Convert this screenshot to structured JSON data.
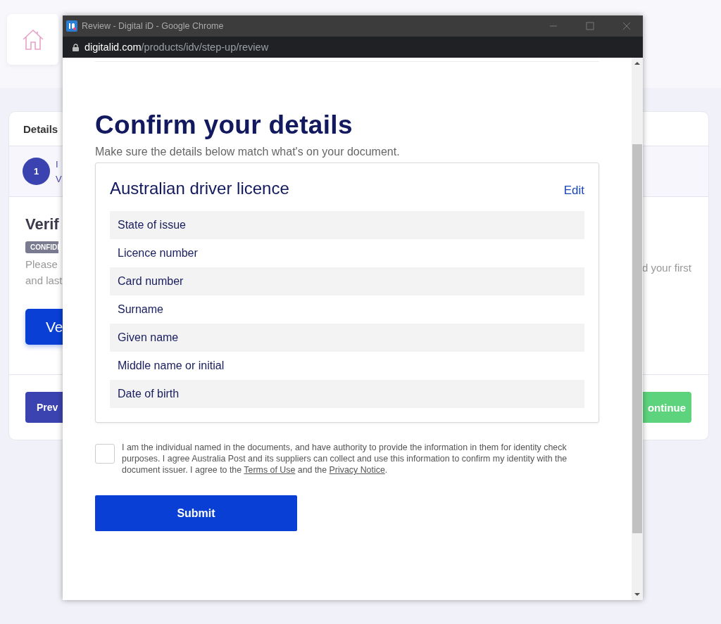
{
  "background_page": {
    "tab": "Details",
    "step": {
      "number": "1",
      "title": "I",
      "subtitle": "V"
    },
    "heading": "Verif",
    "badge": "CONFIDI",
    "text_left": [
      "Please",
      "and last"
    ],
    "text_right": "d your first",
    "primary_button": "Ve",
    "previous_button": "Prev",
    "continue_button": "ontinue"
  },
  "popup": {
    "window_title": "Review - Digital iD - Google Chrome",
    "url_host": "digitalid.com",
    "url_path": "/products/idv/step-up/review",
    "heading": "Confirm your details",
    "subtitle": "Make sure the details below match what's on your document.",
    "document": {
      "title": "Australian driver licence",
      "edit": "Edit",
      "fields": [
        "State of issue",
        "Licence number",
        "Card number",
        "Surname",
        "Given name",
        "Middle name or initial",
        "Date of birth"
      ]
    },
    "consent": {
      "checked": false,
      "text_before": "I am the individual named in the documents, and have authority to provide the information in them for identity check purposes. I agree Australia Post and its suppliers can collect and use this information to confirm my identity with the document issuer. I agree to the",
      "terms_link": "Terms of Use",
      "text_middle": "and the",
      "privacy_link": "Privacy Notice",
      "text_end": "."
    },
    "submit": "Submit"
  }
}
